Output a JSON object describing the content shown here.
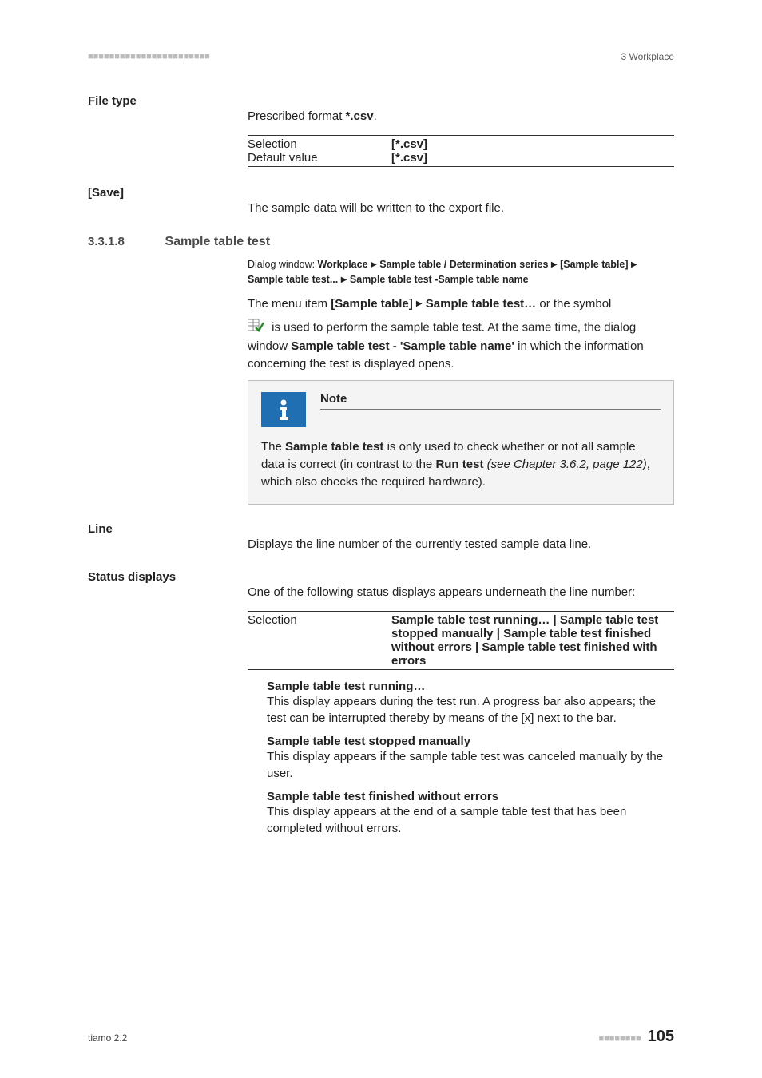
{
  "header": {
    "dashes": "■■■■■■■■■■■■■■■■■■■■■■■",
    "right": "3 Workplace"
  },
  "file_type": {
    "label": "File type",
    "text_pre": "Prescribed format ",
    "text_bold": "*.csv",
    "text_post": ".",
    "rows": [
      {
        "k": "Selection",
        "v": "[*.csv]"
      },
      {
        "k": "Default value",
        "v": "[*.csv]"
      }
    ]
  },
  "save": {
    "label": "[Save]",
    "text": "The sample data will be written to the export file."
  },
  "section": {
    "num": "3.3.1.8",
    "title": "Sample table test",
    "breadcrumb": {
      "lbl": "Dialog window: ",
      "parts": [
        "Workplace",
        "Sample table / Determination series",
        "[Sample table]",
        "Sample table test...",
        "Sample table test -Sample table name"
      ]
    },
    "para1_a": "The menu item ",
    "para1_b": "[Sample table]",
    "para1_c": "Sample table test…",
    "para1_d": " or the symbol",
    "para2_a": " is used to perform the sample table test. At the same time, the dialog window ",
    "para2_b": "Sample table test - 'Sample table name'",
    "para2_c": " in which the information concerning the test is displayed opens.",
    "note": {
      "title": "Note",
      "a": "The ",
      "b": "Sample table test",
      "c": " is only used to check whether or not all sample data is correct (in contrast to the ",
      "d": "Run test",
      "e": " (see Chapter 3.6.2, page 122)",
      "f": ", which also checks the required hardware)."
    }
  },
  "line": {
    "label": "Line",
    "text": "Displays the line number of the currently tested sample data line."
  },
  "status": {
    "label": "Status displays",
    "intro": "One of the following status displays appears underneath the line number:",
    "sel_key": "Selection",
    "sel_parts": [
      "Sample table test running…",
      "Sample table test stopped manually",
      "Sample table test finished without errors",
      "Sample table test finished with errors"
    ],
    "items": [
      {
        "h": "Sample table test running…",
        "d": "This display appears during the test run. A progress bar also appears; the test can be interrupted thereby by means of the [x] next to the bar."
      },
      {
        "h": "Sample table test stopped manually",
        "d": "This display appears if the sample table test was canceled manually by the user."
      },
      {
        "h": "Sample table test finished without errors",
        "d": "This display appears at the end of a sample table test that has been completed without errors."
      }
    ]
  },
  "footer": {
    "left": "tiamo 2.2",
    "dashes": "■■■■■■■■",
    "page": "105"
  }
}
